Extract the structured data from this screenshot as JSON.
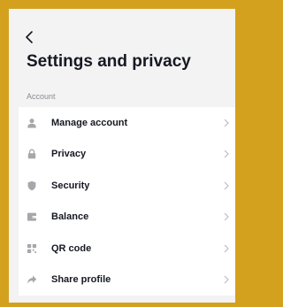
{
  "header": {
    "back_icon": "chevron-left-icon",
    "title": "Settings and privacy"
  },
  "sections": [
    {
      "header": "Account",
      "items": [
        {
          "label": "Manage account",
          "icon": "person-icon"
        },
        {
          "label": "Privacy",
          "icon": "lock-icon"
        },
        {
          "label": "Security",
          "icon": "shield-icon"
        },
        {
          "label": "Balance",
          "icon": "wallet-icon"
        },
        {
          "label": "QR code",
          "icon": "qr-code-icon"
        },
        {
          "label": "Share profile",
          "icon": "share-arrow-icon"
        }
      ]
    }
  ],
  "colors": {
    "border": "#d4a11e",
    "background": "#f3f3f3",
    "card": "#ffffff",
    "text": "#161823",
    "muted": "#8a8b91",
    "icon": "#a6a6ab"
  }
}
